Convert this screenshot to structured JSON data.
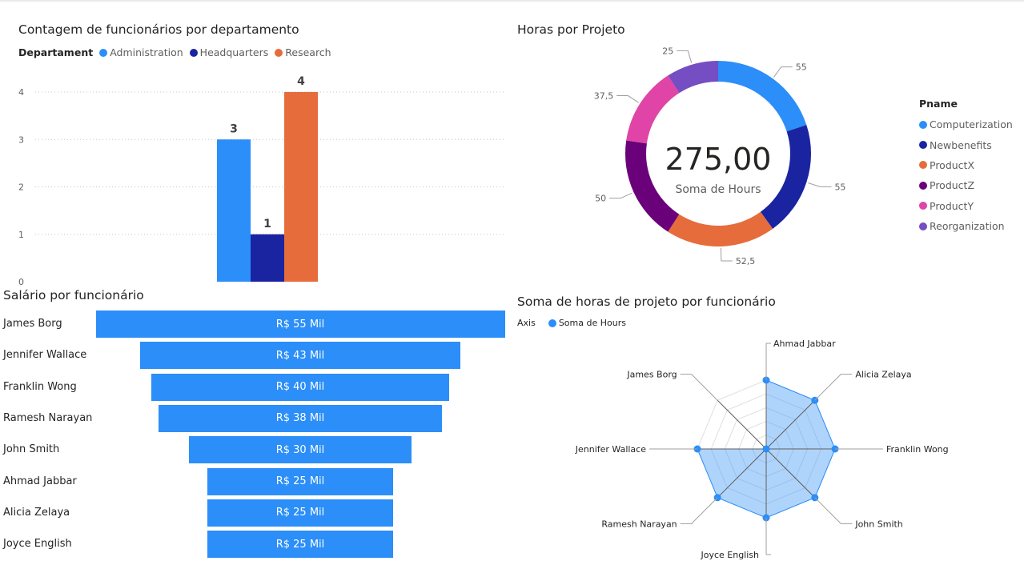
{
  "colors": {
    "administration": "#2c8ef8",
    "headquarters": "#1a24a0",
    "research": "#e66c3c",
    "computerization": "#2c8ef8",
    "newbenefits": "#1a24a0",
    "productx": "#e66c3c",
    "productz": "#6b007b",
    "producty": "#e044a7",
    "reorganization": "#744ec2",
    "funnel": "#2c8ef8",
    "radar": "#2c8ef8"
  },
  "chart_data": [
    {
      "type": "bar",
      "title": "Contagem de funcionários por departamento",
      "legend_title": "Departament",
      "legend_placement": "top-left",
      "series": [
        {
          "name": "Administration",
          "values": [
            3
          ]
        },
        {
          "name": "Headquarters",
          "values": [
            1
          ]
        },
        {
          "name": "Research",
          "values": [
            4
          ]
        }
      ],
      "data_labels": [
        "3",
        "1",
        "4"
      ],
      "yticks": [
        "0",
        "1",
        "2",
        "3",
        "4"
      ],
      "ylim": [
        0,
        4
      ],
      "grid": true
    },
    {
      "type": "pie",
      "title": "Horas por Projeto",
      "legend_title": "Pname",
      "legend_placement": "right",
      "center_value": "275,00",
      "center_label": "Soma de Hours",
      "categories": [
        "Computerization",
        "Newbenefits",
        "ProductX",
        "ProductZ",
        "ProductY",
        "Reorganization"
      ],
      "values": [
        55,
        55,
        52.5,
        50,
        37.5,
        25
      ],
      "data_labels": [
        "55",
        "55",
        "52,5",
        "50",
        "37,5",
        "25"
      ]
    },
    {
      "type": "bar",
      "title": "Salário por funcionário",
      "categories": [
        "James Borg",
        "Jennifer Wallace",
        "Franklin Wong",
        "Ramesh Narayan",
        "John Smith",
        "Ahmad Jabbar",
        "Alicia Zelaya",
        "Joyce English"
      ],
      "values": [
        55,
        43,
        40,
        38,
        30,
        25,
        25,
        25
      ],
      "data_labels": [
        "R$ 55 Mil",
        "R$ 43 Mil",
        "R$ 40 Mil",
        "R$ 38 Mil",
        "R$ 30 Mil",
        "R$ 25 Mil",
        "R$ 25 Mil",
        "R$ 25 Mil"
      ]
    },
    {
      "type": "scatter",
      "title": "Soma de horas de projeto por funcionário",
      "legend_title": "Axis",
      "series": [
        {
          "name": "Soma de Hours",
          "values": [
            40,
            40,
            40,
            40,
            40,
            40,
            40,
            0
          ]
        }
      ],
      "categories": [
        "Ahmad Jabbar",
        "Alicia Zelaya",
        "Franklin Wong",
        "John Smith",
        "Joyce English",
        "Ramesh Narayan",
        "Jennifer Wallace",
        "James Borg"
      ],
      "grid": true
    }
  ]
}
